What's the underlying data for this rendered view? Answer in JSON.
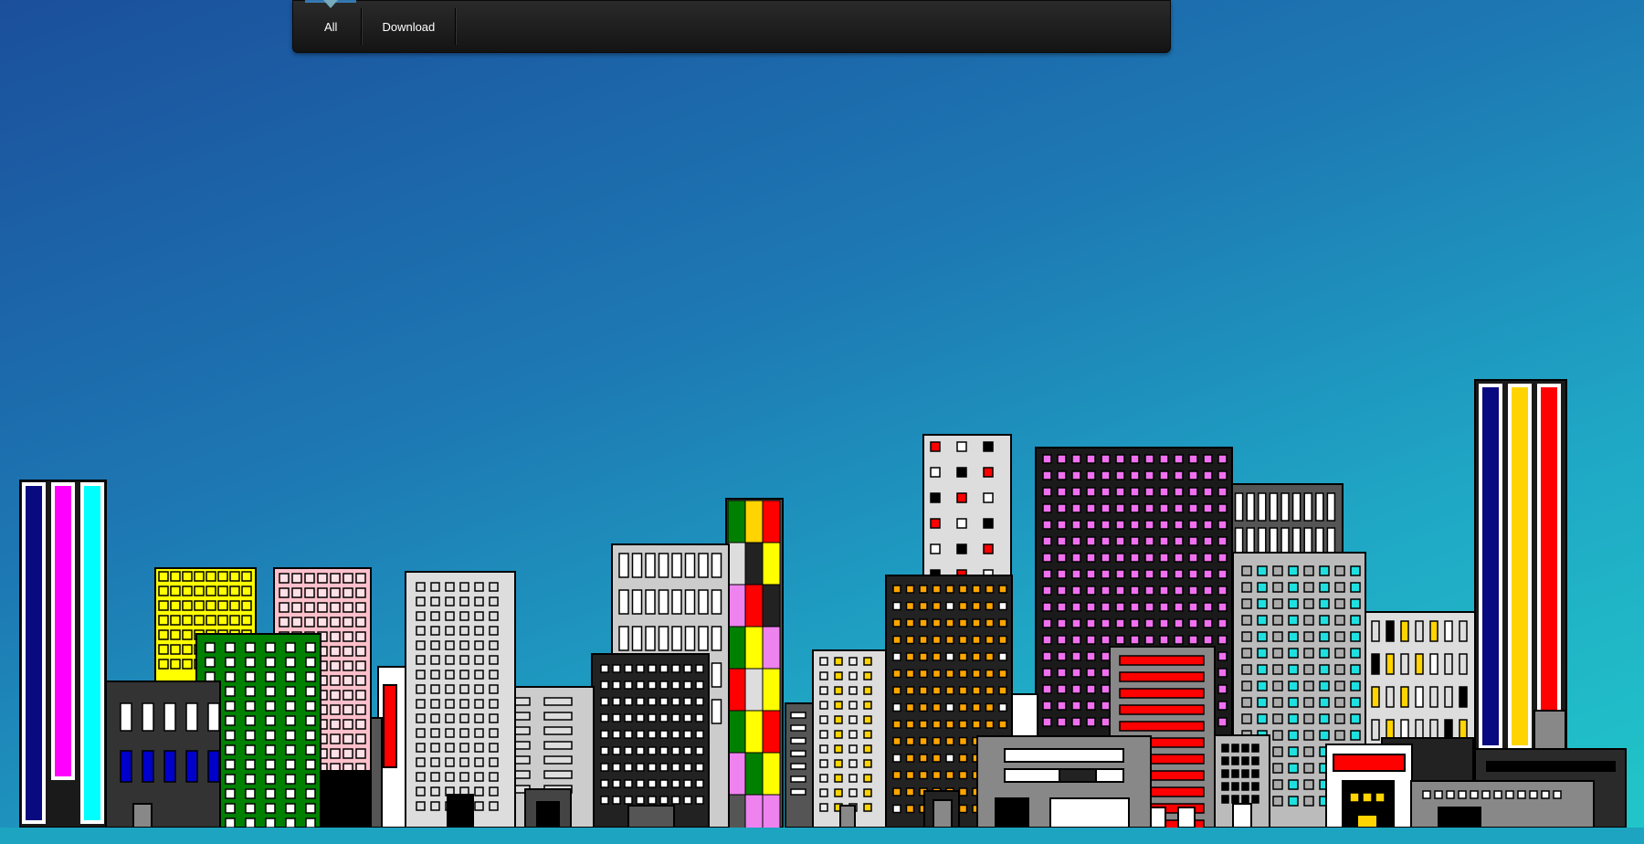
{
  "nav": {
    "items": [
      {
        "label": "All"
      },
      {
        "label": "Download"
      }
    ]
  },
  "colors": {
    "sky_top": "#1b4f9c",
    "sky_bottom": "#21c7c9",
    "nav_bg": "#1a1a1a"
  },
  "scene": {
    "name": "city-skyline",
    "icon": "skyline-illustration"
  }
}
